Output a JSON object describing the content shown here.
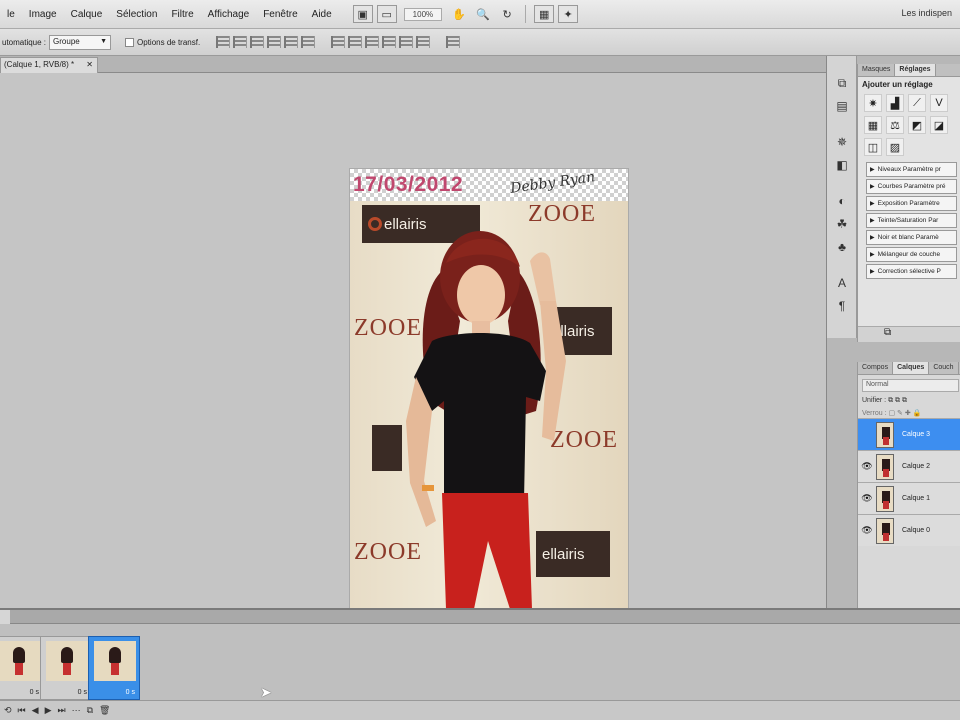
{
  "menubar": {
    "items": [
      "le",
      "Image",
      "Calque",
      "Sélection",
      "Filtre",
      "Affichage",
      "Fenêtre",
      "Aide"
    ],
    "zoom": "100%",
    "workspace": "Les indispen"
  },
  "options_bar": {
    "auto_label": "utomatique :",
    "auto_value": "Groupe",
    "transform_label": "Options de transf."
  },
  "document": {
    "tab_title": "(Calque 1, RVB/8) *",
    "date_text": "17/03/2012",
    "signature_text": "Debby Ryan",
    "logo_text": "ellairis",
    "brand_text": "ZOOE"
  },
  "adjustments_panel": {
    "tabs": [
      "Masques",
      "Réglages"
    ],
    "title": "Ajouter un réglage",
    "presets": [
      "Niveaux Paramètre pr",
      "Courbes Paramètre pré",
      "Exposition Paramètre",
      "Teinte/Saturation Par",
      "Noir et blanc Paramè",
      "Mélangeur de couche",
      "Correction sélective P"
    ]
  },
  "layers_panel": {
    "tabs": [
      "Compos",
      "Calques",
      "Couch"
    ],
    "blend_mode": "Normal",
    "unify_label": "Unifier :",
    "lock_label": "Verrou :",
    "layers": [
      {
        "name": "Calque 3",
        "selected": true,
        "visible": false
      },
      {
        "name": "Calque 2",
        "selected": false,
        "visible": true
      },
      {
        "name": "Calque 1",
        "selected": false,
        "visible": true
      },
      {
        "name": "Calque 0",
        "selected": false,
        "visible": true
      }
    ]
  },
  "animation_panel": {
    "frames": [
      {
        "delay": "0 s",
        "selected": false
      },
      {
        "delay": "0 s",
        "selected": false
      },
      {
        "delay": "0 s",
        "selected": true
      }
    ]
  },
  "colors": {
    "selection": "#3d8ef0",
    "date_pink": "#c0476e"
  }
}
